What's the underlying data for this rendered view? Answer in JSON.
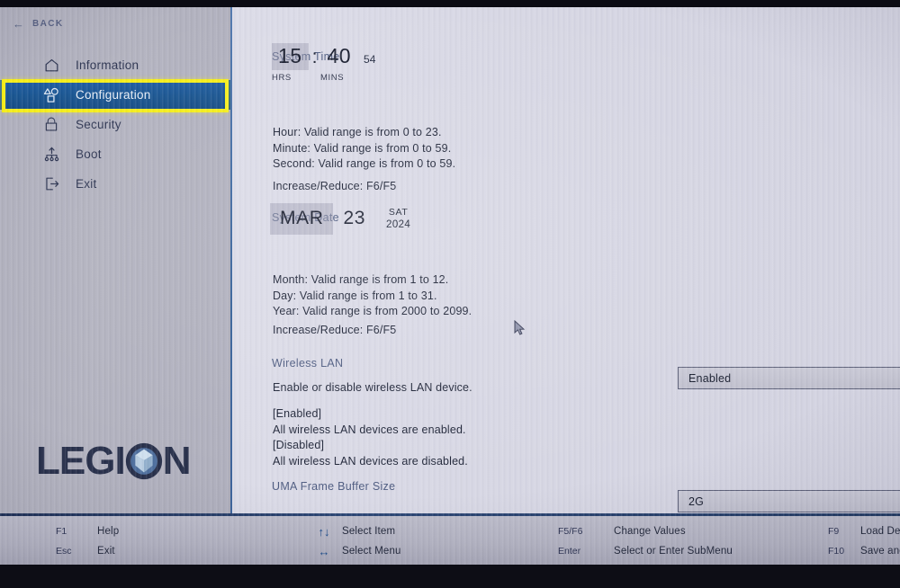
{
  "window": {
    "back_label": "BACK",
    "back_icon": "arrow-left-icon",
    "brand": "LEGION"
  },
  "sidebar": {
    "items": [
      {
        "label": "Information",
        "icon": "home-icon",
        "active": false
      },
      {
        "label": "Configuration",
        "icon": "shapes-icon",
        "active": true
      },
      {
        "label": "Security",
        "icon": "lock-icon",
        "active": false
      },
      {
        "label": "Boot",
        "icon": "boot-order-icon",
        "active": false
      },
      {
        "label": "Exit",
        "icon": "exit-icon",
        "active": false
      }
    ]
  },
  "content": {
    "system_time": {
      "title": "System Time",
      "hours": "15",
      "separator": ":",
      "minutes": "40",
      "seconds": "54",
      "hours_unit": "HRS",
      "minutes_unit": "MINS",
      "help": "Hour: Valid range is from 0 to 23.\nMinute: Valid range is from 0 to 59.\nSecond: Valid range is from 0 to 59.",
      "shortcut": "Increase/Reduce: F6/F5"
    },
    "system_date": {
      "title": "System Date",
      "month": "MAR",
      "day": "23",
      "weekday": "SAT",
      "year": "2024",
      "help": "Month: Valid range is from 1 to 12.\nDay: Valid range is from 1 to 31.\nYear: Valid range is from 2000 to 2099.",
      "shortcut": "Increase/Reduce: F6/F5"
    },
    "wireless_lan": {
      "title": "Wireless LAN",
      "description": "Enable or disable wireless LAN device.",
      "help": "[Enabled]\nAll wireless LAN devices are enabled.\n[Disabled]\nAll wireless LAN devices are disabled.",
      "value": "Enabled"
    },
    "uma_frame_buffer": {
      "title": "UMA Frame Buffer Size",
      "value": "2G"
    }
  },
  "footer": {
    "columns": [
      [
        {
          "key": "F1",
          "action": "Help"
        },
        {
          "key": "Esc",
          "action": "Exit"
        }
      ],
      [
        {
          "key": "↑↓",
          "action": "Select Item"
        },
        {
          "key": "↔",
          "action": "Select Menu"
        }
      ],
      [
        {
          "key": "F5/F6",
          "action": "Change Values"
        },
        {
          "key": "Enter",
          "action": "Select or Enter SubMenu"
        }
      ],
      [
        {
          "key": "F9",
          "action": "Load Defau"
        },
        {
          "key": "F10",
          "action": "Save and E"
        }
      ]
    ]
  },
  "colors": {
    "accent_blue": "#17538f",
    "focus_yellow": "#f5ed18",
    "content_bg": "#d7d7e4",
    "sidebar_bg": "#b0b0be",
    "section_title": "#4d5b80"
  }
}
